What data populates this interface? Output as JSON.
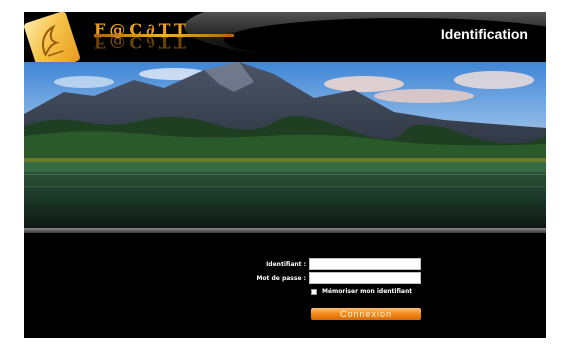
{
  "header": {
    "title": "Identification",
    "brand_text": "F@C∂TT",
    "logo_icon": "folder-logo-icon"
  },
  "form": {
    "username_label": "Identifiant :",
    "username_value": "",
    "password_label": "Mot de passe :",
    "password_value": "",
    "remember_label": "Mémoriser mon identifiant",
    "remember_checked": false,
    "submit_label": "Connexion"
  },
  "colors": {
    "accent": "#f28a1a",
    "background": "#000000",
    "title_text": "#ffffff"
  }
}
